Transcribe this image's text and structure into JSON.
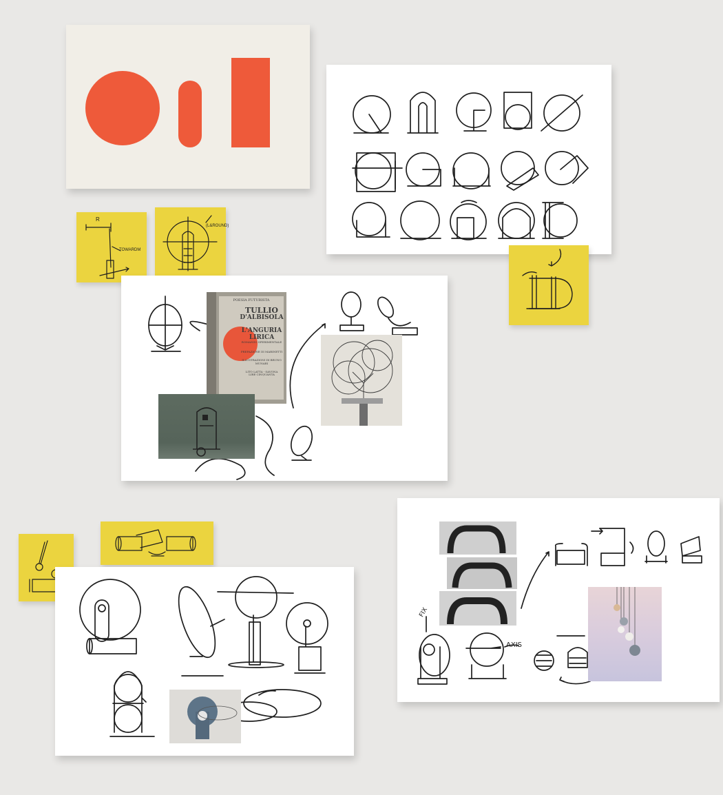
{
  "colors": {
    "background": "#e9e8e6",
    "card": "#ffffff",
    "cream_card": "#f1eee7",
    "sticky_note": "#ebd43f",
    "accent_red": "#ee5a3a",
    "ink": "#1e1e1e"
  },
  "sticky_notes": {
    "radius_note": {
      "label_r": "R",
      "label_axis": "TOWARDM"
    },
    "orbit_note": {
      "label_axis": "(L&ROUND)"
    }
  },
  "book": {
    "lines": [
      "POESIA FUTURISTA",
      "TULLIO",
      "D'ALBISOLA",
      "L'ANGURIA",
      "LIRICA",
      "ROMANZO SPERIMENTALE"
    ],
    "credits": [
      "PREFAZIONE DI MARINETTI",
      "ILLUSTRAZIONI DI BRUNO MUNARI",
      "LITO LATTA - SAVONA",
      "LIRE CINQUANTA"
    ]
  },
  "sketch_labels": {
    "axis_label": "AXIS",
    "fix_label": "FIX"
  }
}
